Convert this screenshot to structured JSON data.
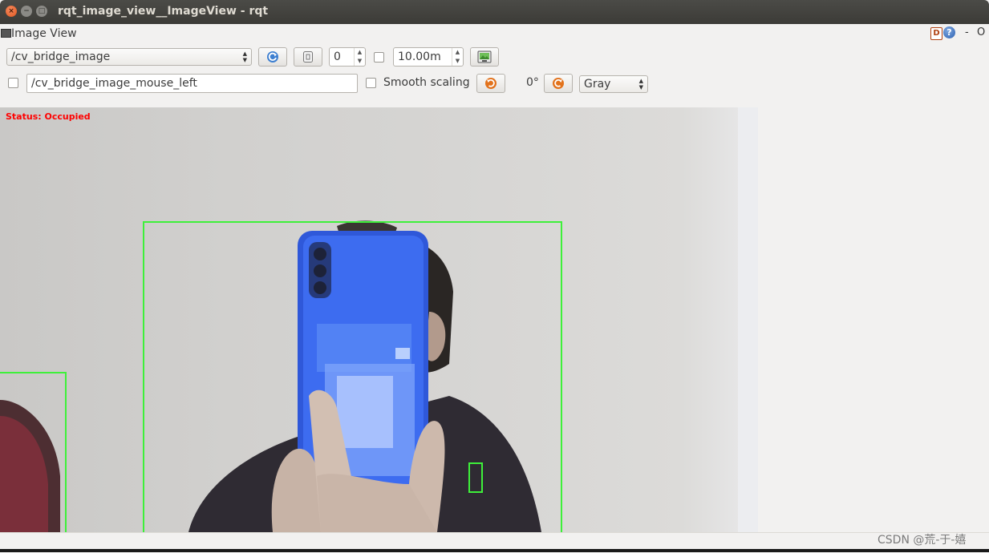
{
  "window": {
    "title": "rqt_image_view__ImageView - rqt",
    "close_glyph": "×",
    "min_glyph": "−",
    "max_glyph": "□"
  },
  "plugin": {
    "title": "Image View",
    "help_d_label": "D",
    "help_q_label": "?",
    "min_label": "-",
    "close_label": "O"
  },
  "toolbar": {
    "topic_combo": "/cv_bridge_image",
    "spin_value": "0",
    "max_range_value": "10.00m",
    "mouse_topic_value": "/cv_bridge_image_mouse_left",
    "smooth_scaling_label": "Smooth scaling",
    "rotation_label": "0°",
    "color_scheme": "Gray"
  },
  "image": {
    "status_text": "Status: Occupied",
    "box_color": "#3ef03a",
    "status_color": "#ff0000"
  },
  "watermark": "CSDN @荒-于-嬉",
  "icons": {
    "refresh": "refresh-icon",
    "zoom_fit": "zoom-fit-icon",
    "save": "save-image-icon",
    "rotate_left": "rotate-left-icon",
    "rotate_right": "rotate-right-icon"
  }
}
